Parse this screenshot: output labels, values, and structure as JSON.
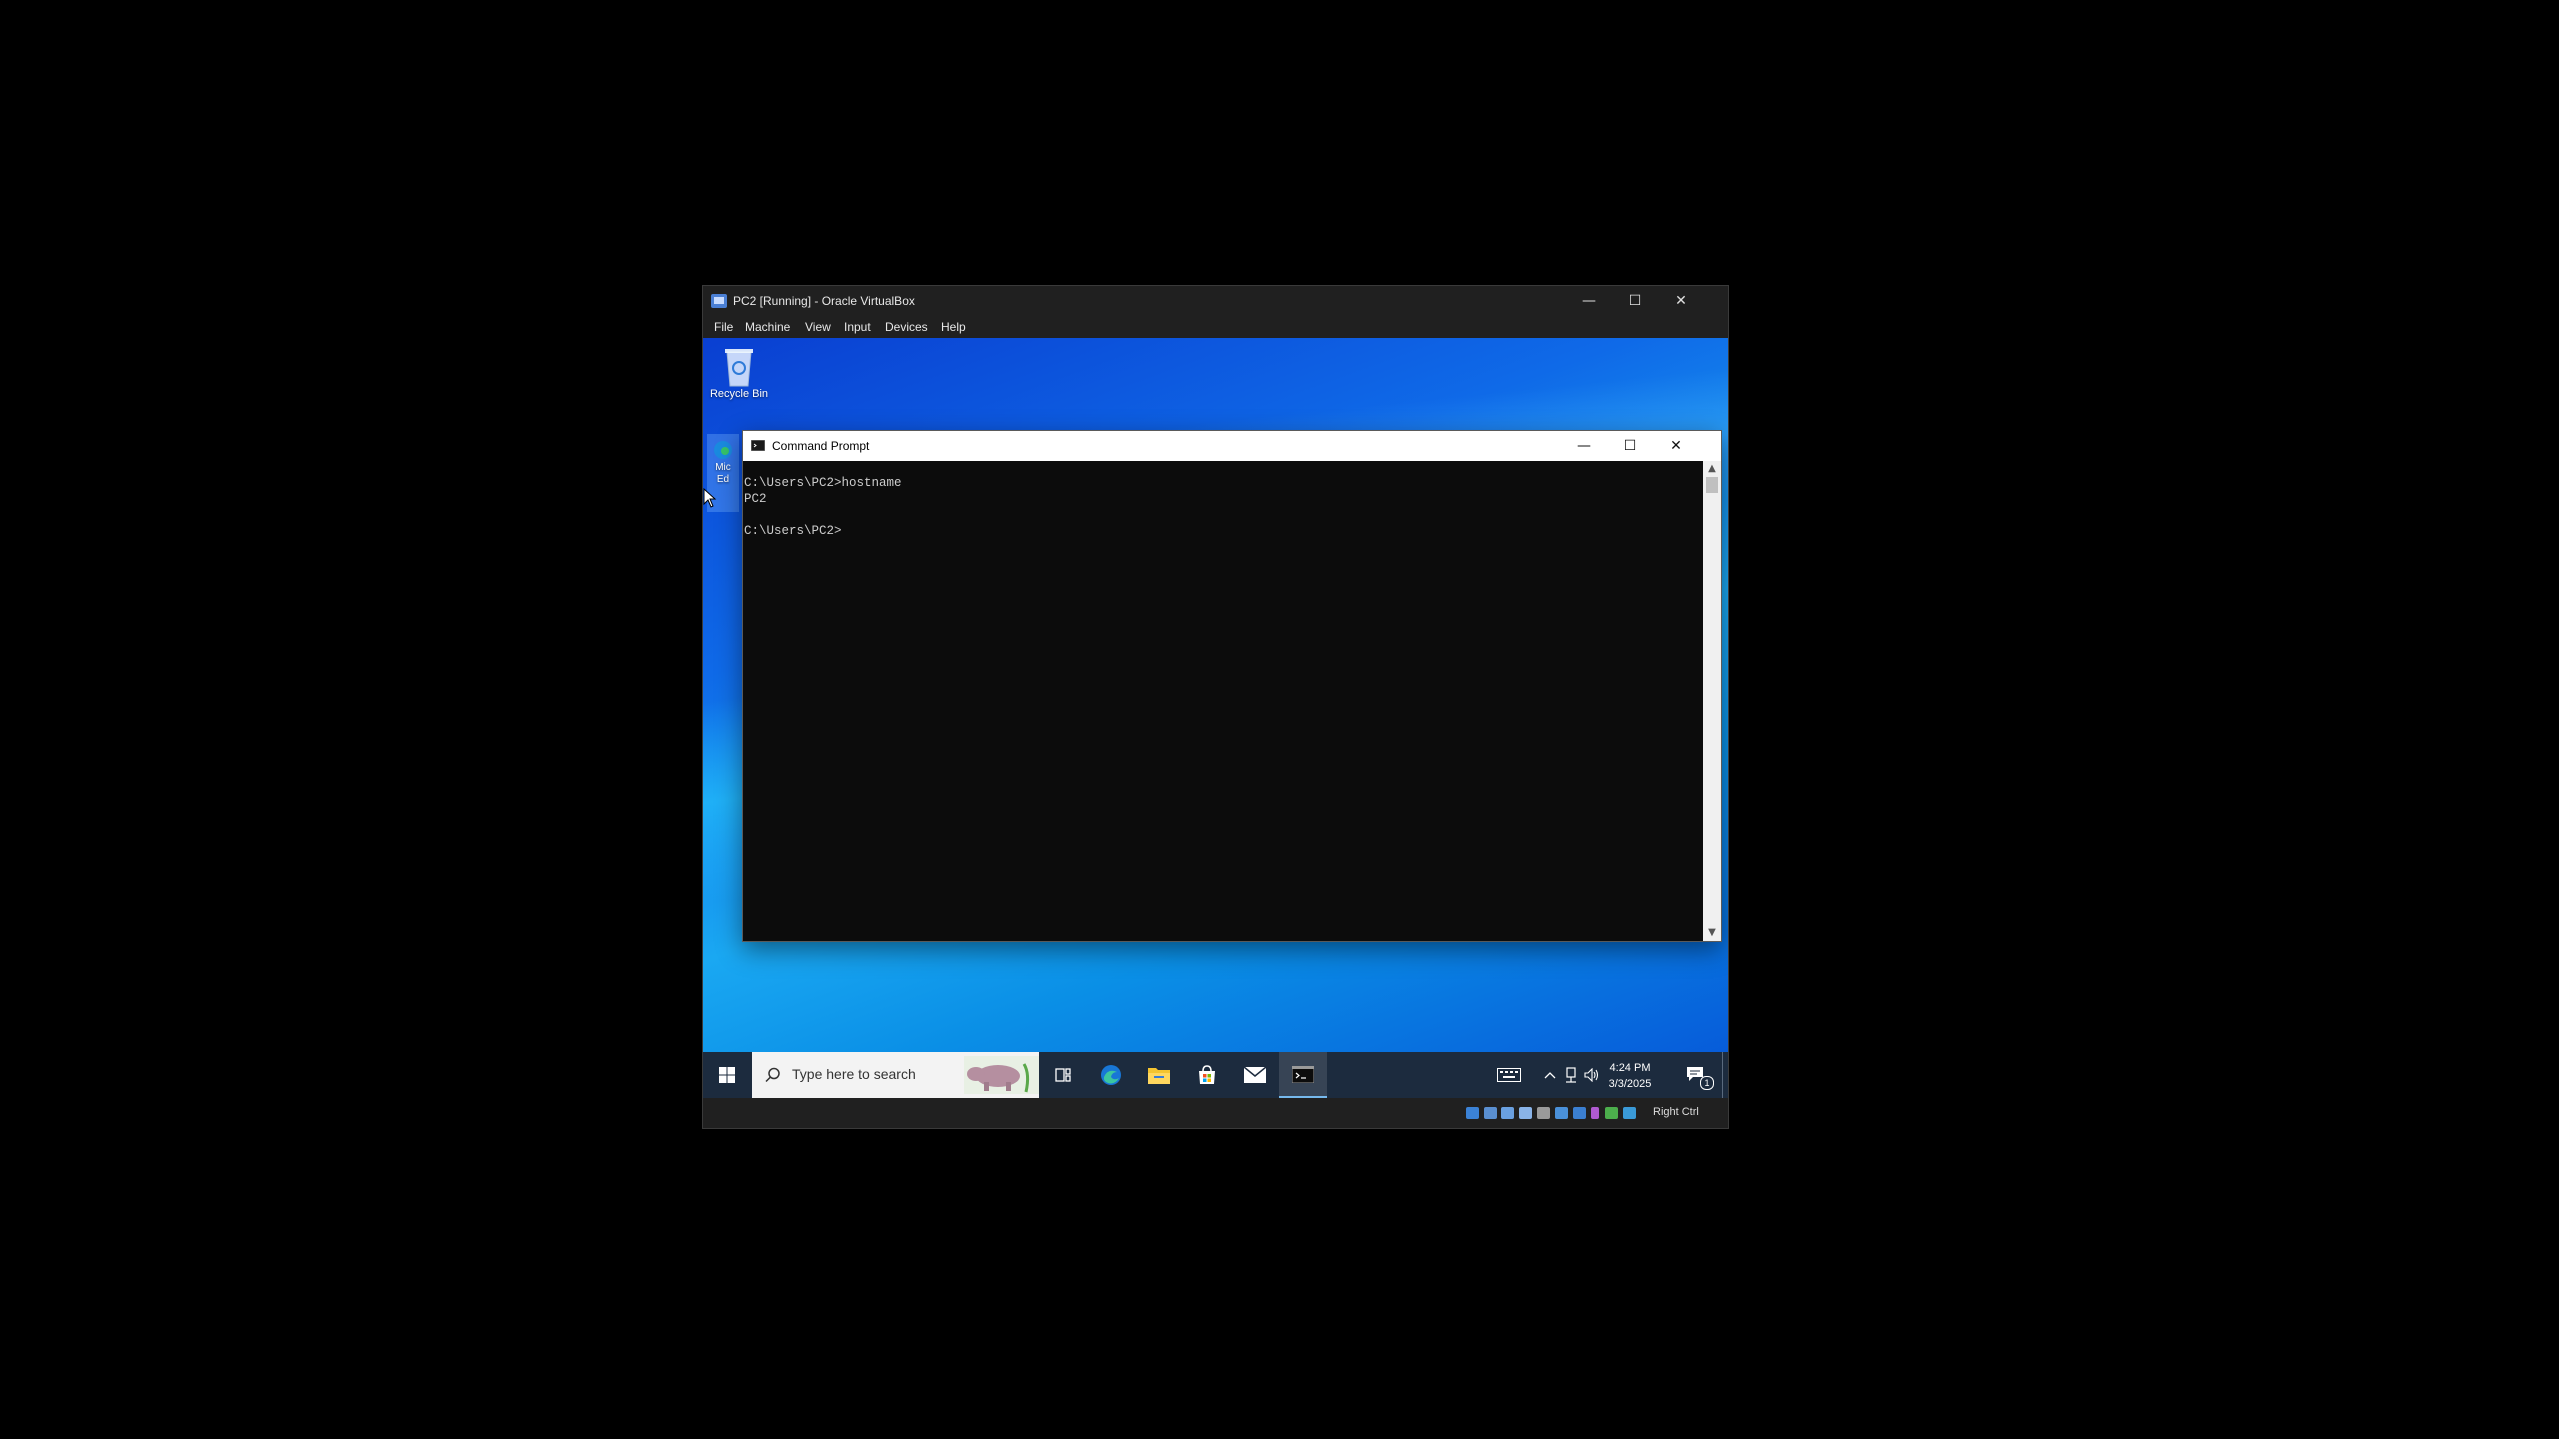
{
  "host_window": {
    "title": "PC2 [Running] - Oracle VirtualBox",
    "controls": {
      "minimize": "—",
      "maximize": "☐",
      "close": "✕"
    },
    "menu": [
      "File",
      "Machine",
      "View",
      "Input",
      "Devices",
      "Help"
    ],
    "status_bar": {
      "host_key": "Right Ctrl"
    }
  },
  "desktop": {
    "icons": [
      {
        "label": "Recycle Bin",
        "icon": "recycle-bin-icon"
      },
      {
        "label": "Mic\nEd",
        "icon": "edge-shortcut-icon"
      }
    ]
  },
  "cmd_window": {
    "title": "Command Prompt",
    "controls": {
      "minimize": "—",
      "maximize": "☐",
      "close": "✕"
    },
    "lines": [
      "C:\\Users\\PC2>hostname",
      "PC2",
      "",
      "C:\\Users\\PC2>"
    ]
  },
  "taskbar": {
    "search_placeholder": "Type here to search",
    "pinned": [
      "task-view-icon",
      "edge-icon",
      "file-explorer-icon",
      "microsoft-store-icon",
      "mail-icon",
      "command-prompt-icon"
    ],
    "clock": {
      "time": "4:24 PM",
      "date": "3/3/2025"
    },
    "notification_count": "1"
  },
  "colors": {
    "host_chrome": "#202020",
    "taskbar": "#1c2b3e",
    "console_bg": "#0c0c0c",
    "console_text": "#cccccc",
    "accent": "#0a6cf0"
  }
}
